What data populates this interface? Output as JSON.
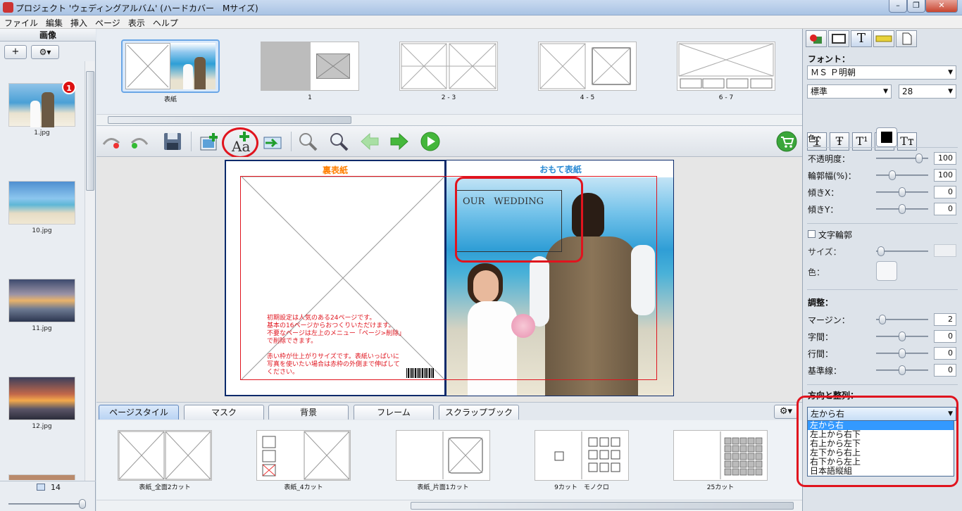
{
  "window": {
    "title": "プロジェクト 'ウェディングアルバム' (ハードカバー　Mサイズ)",
    "min_glyph": "–",
    "max_glyph": "❐",
    "close_glyph": "✕"
  },
  "menu": [
    "ファイル",
    "編集",
    "挿入",
    "ページ",
    "表示",
    "ヘルプ"
  ],
  "left_panel": {
    "header": "画像",
    "add_glyph": "+",
    "gear_glyph": "⚙▾",
    "images": [
      {
        "name": "1.jpg",
        "badge": "1"
      },
      {
        "name": "10.jpg",
        "badge": ""
      },
      {
        "name": "11.jpg",
        "badge": ""
      },
      {
        "name": "12.jpg",
        "badge": ""
      }
    ],
    "count": "14"
  },
  "pages": [
    {
      "label": "表紙"
    },
    {
      "label": "1"
    },
    {
      "label": "2 - 3"
    },
    {
      "label": "4 - 5"
    },
    {
      "label": "6 - 7"
    }
  ],
  "canvas": {
    "back_cover_label": "裏表紙",
    "front_cover_label": "おもて表紙",
    "textbox_text": "OUR　WEDDING",
    "note_lines": [
      "初期設定は人気のある24ページです。",
      "基本の16ページからおつくりいただけます。",
      "不要なページは左上のメニュー「ページ>削除」",
      "で削除できます。",
      "",
      "赤い枠が仕上がりサイズです。表紙いっぱいに",
      "写真を使いたい場合は赤枠の外側まで伸ばして",
      "ください。"
    ]
  },
  "tabs": [
    "ページスタイル",
    "マスク",
    "背景",
    "フレーム",
    "スクラップブック"
  ],
  "styles": [
    {
      "label": "表紙_全面2カット"
    },
    {
      "label": "表紙_4カット"
    },
    {
      "label": "表紙_片面1カット"
    },
    {
      "label": "9カット　モノクロ"
    },
    {
      "label": "25カット"
    }
  ],
  "right_panel": {
    "font_label": "フォント：",
    "font_value": "ＭＳ Ｐ明朝",
    "style_value": "標準",
    "size_value": "28",
    "fmt_buttons": [
      "T",
      "Ŧ",
      "T¹",
      "T₁",
      "Tт"
    ],
    "color_label": "色：",
    "text_color": "#000000",
    "props": [
      {
        "label": "不透明度：",
        "value": "100",
        "level": 0.88
      },
      {
        "label": "輪郭幅(%)：",
        "value": "100",
        "level": 0.28
      },
      {
        "label": "傾きX：",
        "value": "0",
        "level": 0.5
      },
      {
        "label": "傾きY：",
        "value": "0",
        "level": 0.5
      }
    ],
    "outline_label": "文字輪郭",
    "outline_size_label": "サイズ：",
    "outline_color_label": "色：",
    "adjust_label": "調整：",
    "adjust": [
      {
        "label": "マージン：",
        "value": "2",
        "level": 0.06
      },
      {
        "label": "字間：",
        "value": "0",
        "level": 0.5
      },
      {
        "label": "行間：",
        "value": "0",
        "level": 0.5
      },
      {
        "label": "基準線：",
        "value": "0",
        "level": 0.5
      }
    ],
    "direction_label": "方向と整列：",
    "direction_value": "左から右",
    "direction_options": [
      "左から右",
      "左上から右下",
      "右上から左下",
      "左下から右上",
      "右下から左上",
      "日本語縦組"
    ],
    "selected_index": 0
  },
  "colors": {
    "accent_red": "#e0141e",
    "back_cover_label": "#ff7f00",
    "front_cover_label": "#2a8ad4",
    "note_text": "#e0141e"
  }
}
